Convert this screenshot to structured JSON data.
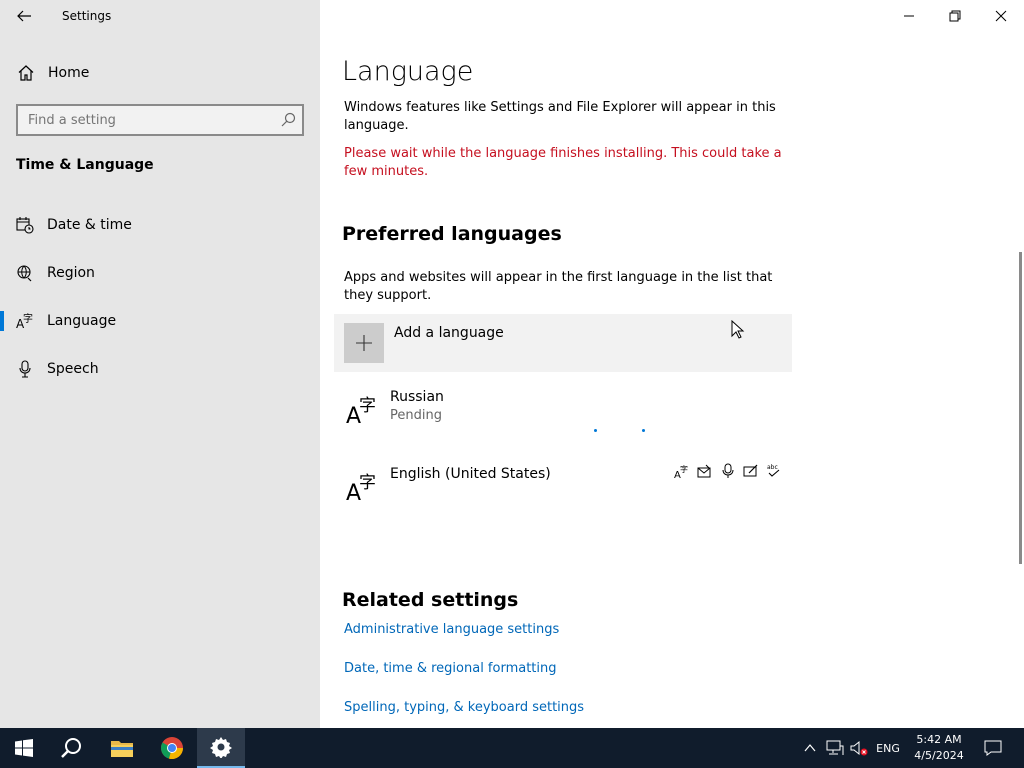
{
  "window": {
    "app_title": "Settings"
  },
  "sidebar": {
    "home_label": "Home",
    "search_placeholder": "Find a setting",
    "section_title": "Time & Language",
    "items": [
      {
        "label": "Date & time",
        "icon": "calendar-clock-icon"
      },
      {
        "label": "Region",
        "icon": "globe-icon"
      },
      {
        "label": "Language",
        "icon": "language-icon",
        "active": true
      },
      {
        "label": "Speech",
        "icon": "microphone-icon"
      }
    ]
  },
  "main": {
    "title": "Language",
    "description": "Windows features like Settings and File Explorer will appear in this language.",
    "warning": "Please wait while the language finishes installing. This could take a few minutes.",
    "preferred_title": "Preferred languages",
    "preferred_desc": "Apps and websites will appear in the first language in the list that they support.",
    "add_language_label": "Add a language",
    "languages": [
      {
        "name": "Russian",
        "status": "Pending"
      },
      {
        "name": "English (United States)",
        "status": ""
      }
    ],
    "related_title": "Related settings",
    "related_links": [
      "Administrative language settings",
      "Date, time & regional formatting",
      "Spelling, typing, & keyboard settings"
    ]
  },
  "taskbar": {
    "lang_indicator": "ENG",
    "time": "5:42 AM",
    "date": "4/5/2024"
  },
  "colors": {
    "accent": "#0078d7",
    "warning": "#c50f1f",
    "link": "#0067b8",
    "sidebar_bg": "#e6e6e6",
    "taskbar_bg": "#101c2c"
  }
}
